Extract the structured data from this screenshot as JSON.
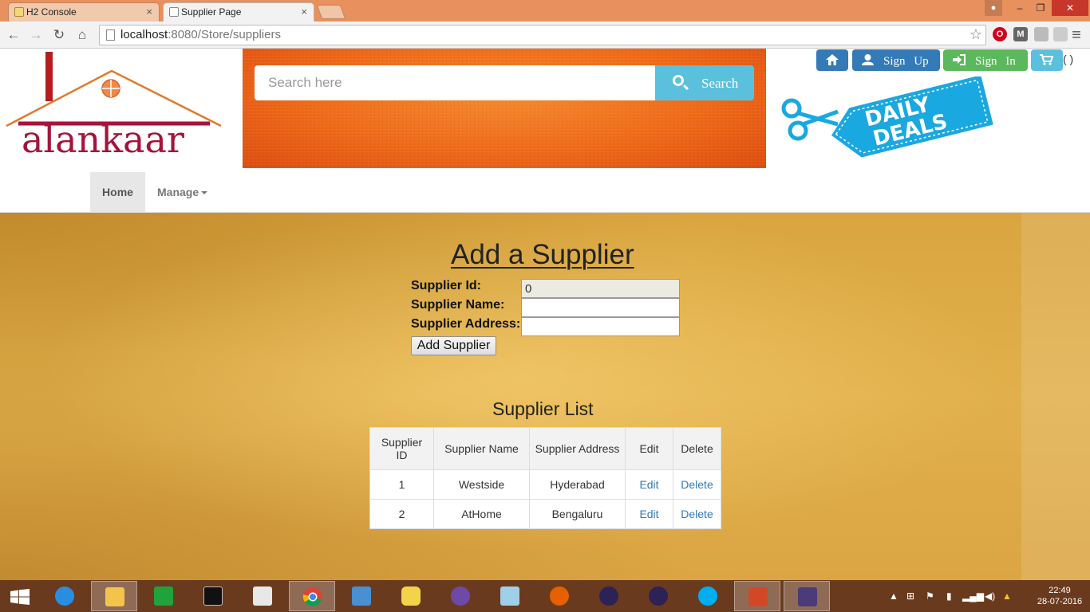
{
  "browser": {
    "tabs": [
      {
        "title": "H2 Console",
        "close": "×"
      },
      {
        "title": "Supplier Page",
        "close": "×"
      }
    ],
    "window_controls": {
      "minimize": "–",
      "maximize": "❐",
      "close": "✕"
    },
    "nav": {
      "back": "←",
      "forward": "→",
      "reload": "↻",
      "home": "⌂"
    },
    "url_host": "localhost",
    "url_path": ":8080/Store/suppliers",
    "bookmark_star": "☆",
    "menu": "≡"
  },
  "header": {
    "logo_text": "alankaar",
    "search": {
      "placeholder": "Search here",
      "button_label": "Search"
    },
    "buttons": {
      "signup": "Sign Up",
      "signin": "Sign In",
      "cart_count": "( )"
    },
    "deals_line1": "DAILY",
    "deals_line2": "DEALS"
  },
  "navbar": {
    "home": "Home",
    "manage": "Manage"
  },
  "form": {
    "title": "Add a Supplier",
    "labels": {
      "id": "Supplier Id:",
      "name": "Supplier Name:",
      "address": "Supplier Address:"
    },
    "values": {
      "id": "0",
      "name": "",
      "address": ""
    },
    "submit": "Add Supplier"
  },
  "list": {
    "title": "Supplier List",
    "headers": {
      "id": "Supplier ID",
      "name": "Supplier Name",
      "address": "Supplier Address",
      "edit": "Edit",
      "delete": "Delete"
    },
    "rows": [
      {
        "id": "1",
        "name": "Westside",
        "address": "Hyderabad",
        "edit": "Edit",
        "delete": "Delete"
      },
      {
        "id": "2",
        "name": "AtHome",
        "address": "Bengaluru",
        "edit": "Edit",
        "delete": "Delete"
      }
    ]
  },
  "taskbar": {
    "time": "22:49",
    "date": "28-07-2016",
    "apps": [
      "start-icon",
      "ie-icon",
      "file-explorer-icon",
      "store-icon",
      "cmd-icon",
      "reader-icon",
      "chrome-icon",
      "remote-icon",
      "database-icon",
      "cat-icon",
      "notes-icon",
      "firefox-icon",
      "eclipse-icon",
      "eclipse-icon",
      "skype-icon",
      "powerpoint-icon",
      "java-ee-ide-icon"
    ]
  },
  "colors": {
    "titlebar": "#e8905e",
    "primary_blue": "#337ab7",
    "success_green": "#5cb85c",
    "info_cyan": "#5bc0de",
    "banner_orange": "#ef6a18",
    "page_gold": "#e1b04c",
    "taskbar": "#6a3a1e"
  }
}
